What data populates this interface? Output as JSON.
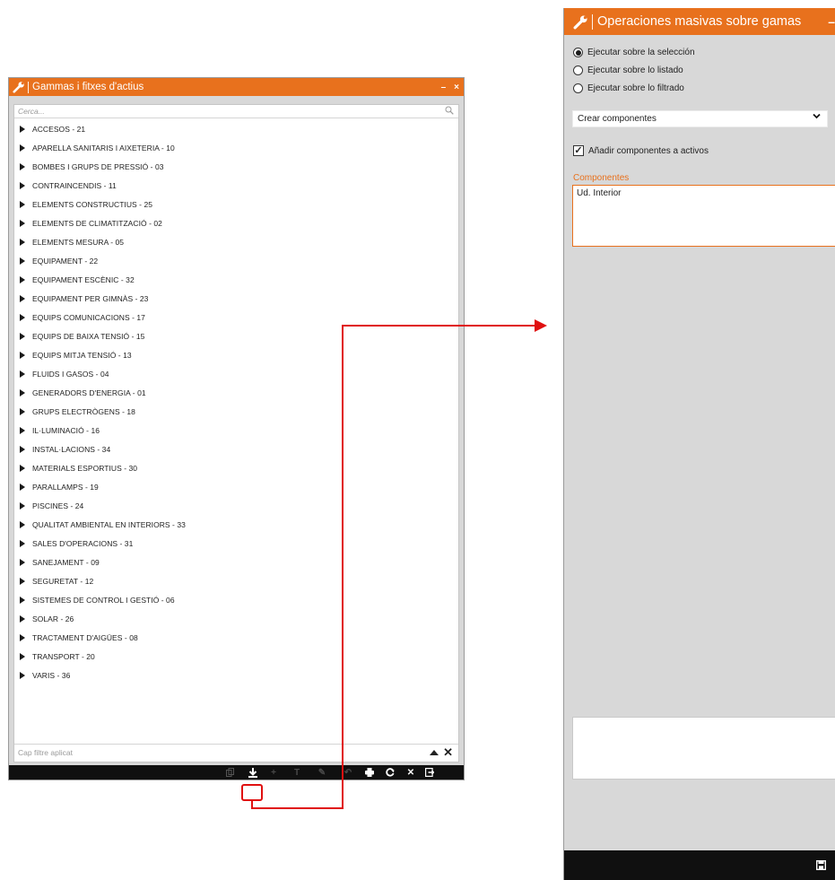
{
  "left_window": {
    "title": "Gammas i fitxes d'actius",
    "minimize_glyph": "–",
    "close_glyph": "×",
    "search_placeholder": "Cerca...",
    "tree_items": [
      "ACCESOS - 21",
      "APARELLA SANITARIS I AIXETERIA - 10",
      "BOMBES I GRUPS DE PRESSIÓ - 03",
      "CONTRAINCENDIS - 11",
      "ELEMENTS CONSTRUCTIUS - 25",
      "ELEMENTS DE CLIMATITZACIÓ - 02",
      "ELEMENTS MESURA - 05",
      "EQUIPAMENT - 22",
      "EQUIPAMENT ESCÈNIC - 32",
      "EQUIPAMENT PER GIMNÀS - 23",
      "EQUIPS COMUNICACIONS - 17",
      "EQUIPS DE BAIXA TENSIÓ - 15",
      "EQUIPS MITJA TENSIÓ - 13",
      "FLUIDS I GASOS - 04",
      "GENERADORS D'ENERGIA - 01",
      "GRUPS ELECTRÒGENS - 18",
      "IL·LUMINACIÓ - 16",
      "INSTAL·LACIONS - 34",
      "MATERIALS ESPORTIUS - 30",
      "PARALLAMPS - 19",
      "PISCINES - 24",
      "QUALITAT AMBIENTAL EN INTERIORS - 33",
      "SALES D'OPERACIONS - 31",
      "SANEJAMENT - 09",
      "SEGURETAT - 12",
      "SISTEMES DE CONTROL I GESTIÓ - 06",
      "SOLAR - 26",
      "TRACTAMENT D'AIGÜES - 08",
      "TRANSPORT - 20",
      "VARIS - 36"
    ],
    "filter_status": "Cap filtre aplicat",
    "footer_icons": [
      "copy-icon",
      "download-icon",
      "add-icon",
      "filter-icon",
      "edit-icon",
      "undo-icon",
      "print-icon",
      "refresh-icon",
      "close-icon",
      "exit-icon"
    ]
  },
  "right_window": {
    "title": "Operaciones masivas sobre gamas",
    "minimize_glyph": "–",
    "radios": [
      {
        "label": "Ejecutar sobre la selección",
        "checked": true
      },
      {
        "label": "Ejecutar sobre lo listado",
        "checked": false
      },
      {
        "label": "Ejecutar sobre lo filtrado",
        "checked": false
      }
    ],
    "operation_selected": "Crear componentes",
    "checkbox_label": "Añadir componentes a activos",
    "checkbox_checked": true,
    "components_label": "Componentes",
    "components_value": "Ud. Interior",
    "footer_icon": "save-icon"
  },
  "colors": {
    "accent": "#e8711d",
    "highlight": "#e01010",
    "footer": "#101010",
    "panel": "#d8d8d8"
  }
}
